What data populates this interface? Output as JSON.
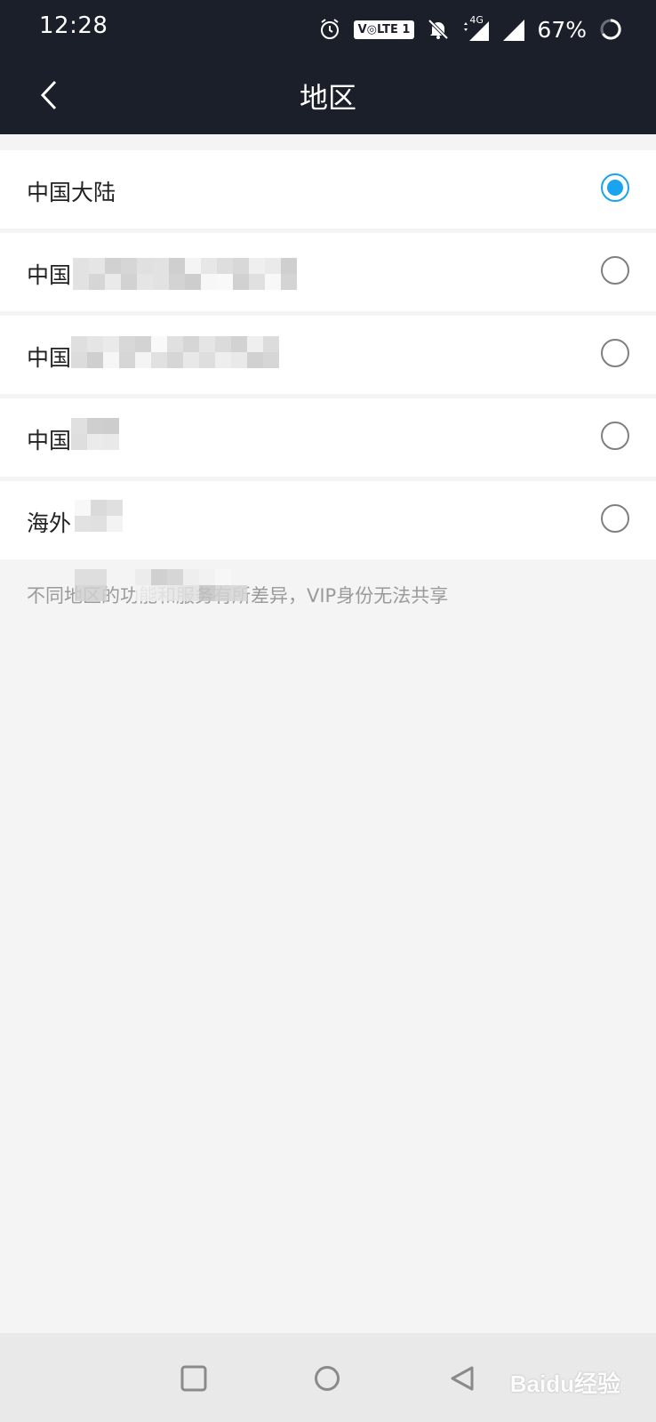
{
  "status_bar": {
    "time": "12:28",
    "volte": "V◎LTE 1",
    "network": "4G",
    "battery": "67%"
  },
  "header": {
    "title": "地区"
  },
  "regions": [
    {
      "label": "中国大陆",
      "selected": true
    },
    {
      "label": "中国",
      "selected": false
    },
    {
      "label": "中国",
      "selected": false
    },
    {
      "label": "中国",
      "selected": false
    },
    {
      "label": "海外",
      "selected": false
    }
  ],
  "note": "不同地区的功能和服务有所差异，VIP身份无法共享",
  "colors": {
    "header_bg": "#1b1f2a",
    "accent": "#1aa3ee",
    "page_bg": "#f4f4f5"
  },
  "watermark": "Baidu经验"
}
